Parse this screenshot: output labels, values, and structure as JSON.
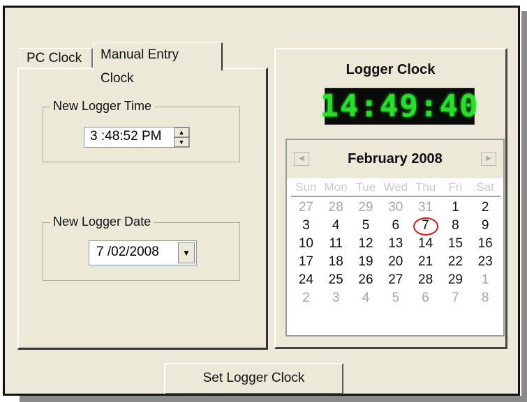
{
  "tabs": [
    "PC Clock",
    "Manual Entry Clock"
  ],
  "time_group": {
    "legend": "New Logger Time",
    "value": "3 :48:52 PM"
  },
  "date_group": {
    "legend": "New Logger Date",
    "value": "7 /02/2008"
  },
  "logger_clock": {
    "title": "Logger Clock",
    "display": "14:49:40",
    "display_color": "#26e02a"
  },
  "calendar": {
    "month_title": "February 2008",
    "prev_icon": "left-arrow-icon",
    "next_icon": "right-arrow-icon",
    "weekdays": [
      "Sun",
      "Mon",
      "Tue",
      "Wed",
      "Thu",
      "Fri",
      "Sat"
    ],
    "weeks": [
      [
        "27",
        "28",
        "29",
        "30",
        "31",
        "1",
        "2"
      ],
      [
        "3",
        "4",
        "5",
        "6",
        "7",
        "8",
        "9"
      ],
      [
        "10",
        "11",
        "12",
        "13",
        "14",
        "15",
        "16"
      ],
      [
        "17",
        "18",
        "19",
        "20",
        "21",
        "22",
        "23"
      ],
      [
        "24",
        "25",
        "26",
        "27",
        "28",
        "29",
        "1"
      ],
      [
        "2",
        "3",
        "4",
        "5",
        "6",
        "7",
        "8"
      ]
    ],
    "today": "7",
    "today_marker_color": "#e21616"
  },
  "set_button": "Set Logger Clock"
}
